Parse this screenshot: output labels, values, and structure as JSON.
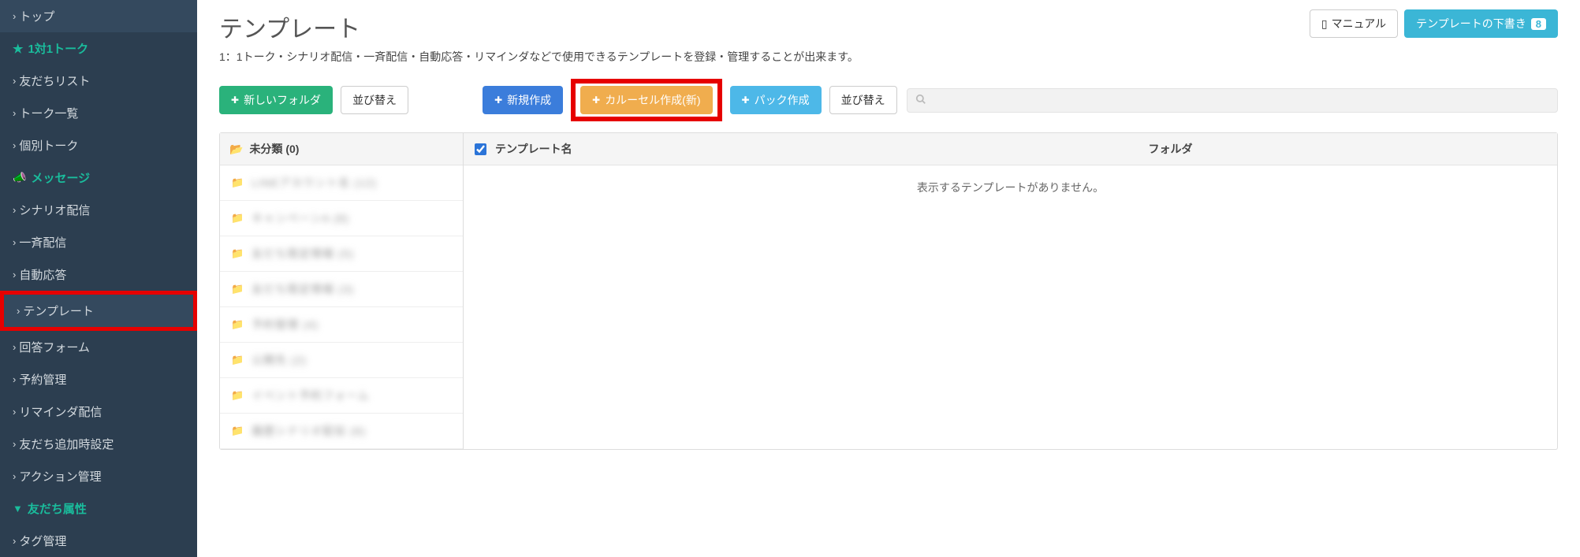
{
  "sidebar": {
    "items": [
      {
        "label": "トップ",
        "type": "link"
      },
      {
        "label": "1対1トーク",
        "type": "section-star"
      },
      {
        "label": "友だちリスト",
        "type": "link"
      },
      {
        "label": "トーク一覧",
        "type": "link"
      },
      {
        "label": "個別トーク",
        "type": "link"
      },
      {
        "label": "メッセージ",
        "type": "section-horn"
      },
      {
        "label": "シナリオ配信",
        "type": "link"
      },
      {
        "label": "一斉配信",
        "type": "link"
      },
      {
        "label": "自動応答",
        "type": "link"
      },
      {
        "label": "テンプレート",
        "type": "link",
        "highlighted": true
      },
      {
        "label": "回答フォーム",
        "type": "link"
      },
      {
        "label": "予約管理",
        "type": "link"
      },
      {
        "label": "リマインダ配信",
        "type": "link"
      },
      {
        "label": "友だち追加時設定",
        "type": "link"
      },
      {
        "label": "アクション管理",
        "type": "link"
      },
      {
        "label": "友だち属性",
        "type": "section-funnel"
      },
      {
        "label": "タグ管理",
        "type": "link"
      }
    ]
  },
  "page": {
    "title": "テンプレート",
    "description": "1：1トーク・シナリオ配信・一斉配信・自動応答・リマインダなどで使用できるテンプレートを登録・管理することが出来ます。"
  },
  "header_buttons": {
    "manual": "マニュアル",
    "drafts_label": "テンプレートの下書き",
    "drafts_count": "8"
  },
  "toolbar": {
    "new_folder": "新しいフォルダ",
    "sort1": "並び替え",
    "new_create": "新規作成",
    "carousel_create": "カルーセル作成(新)",
    "pack_create": "パック作成",
    "sort2": "並び替え",
    "search_placeholder": ""
  },
  "folders": {
    "header": "未分類 (0)",
    "rows": [
      {
        "text": "LINEアカウント名 (12)"
      },
      {
        "text": "キャンペーンA (8)"
      },
      {
        "text": "友だち限定情報 (5)"
      },
      {
        "text": "友だち限定情報 (3)"
      },
      {
        "text": "予約管理 (4)"
      },
      {
        "text": "公開先 (2)"
      },
      {
        "text": "イベント予約フォーム"
      },
      {
        "text": "履歴シナリオ配信 (6)"
      }
    ]
  },
  "table": {
    "col_name": "テンプレート名",
    "col_folder": "フォルダ",
    "empty": "表示するテンプレートがありません。"
  }
}
